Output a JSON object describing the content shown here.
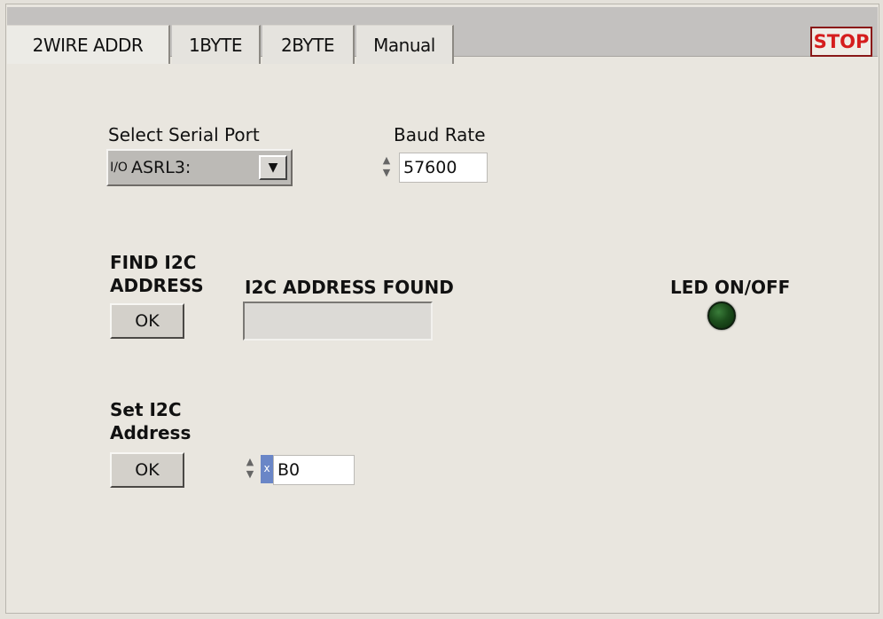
{
  "tabs": [
    {
      "label": "2WIRE ADDR",
      "active": true
    },
    {
      "label": "1BYTE",
      "active": false
    },
    {
      "label": "2BYTE",
      "active": false
    },
    {
      "label": "Manual",
      "active": false
    }
  ],
  "stop_button": {
    "label": "STOP",
    "color": "#d51d1d"
  },
  "serial_port": {
    "label": "Select Serial Port",
    "io_glyph": "I/O",
    "value": "ASRL3:"
  },
  "baud_rate": {
    "label": "Baud Rate",
    "value": "57600"
  },
  "find_i2c": {
    "label_line1": "FIND I2C",
    "label_line2": "ADDRESS",
    "button_label": "OK"
  },
  "i2c_found": {
    "label": "I2C ADDRESS FOUND",
    "value": ""
  },
  "led": {
    "label": "LED ON/OFF",
    "color": "#1c4d1c"
  },
  "set_i2c": {
    "label_line1": "Set I2C",
    "label_line2": "Address",
    "button_label": "OK",
    "radix": "x",
    "value": "B0"
  }
}
